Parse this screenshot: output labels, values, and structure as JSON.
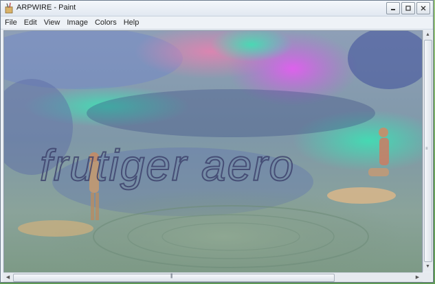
{
  "window": {
    "title": "ARPWIRE - Paint"
  },
  "menu": [
    "File",
    "Edit",
    "View",
    "Image",
    "Colors",
    "Help"
  ],
  "caption_buttons": {
    "minimize_icon": "minimize-icon",
    "maximize_icon": "maximize-icon",
    "close_icon": "close-icon"
  },
  "canvas": {
    "overlay_text": "frutiger aero"
  },
  "scrollbars": {
    "up_arrow": "▲",
    "down_arrow": "▼",
    "left_arrow": "◀",
    "right_arrow": "▶",
    "h_grip": "|||",
    "v_grip": "≡"
  },
  "colors": {
    "titlebar": "#e9eef4",
    "canvas_base": "#9aa9b9",
    "accent_magenta": "#d354e0",
    "accent_teal": "#37d6a8"
  }
}
